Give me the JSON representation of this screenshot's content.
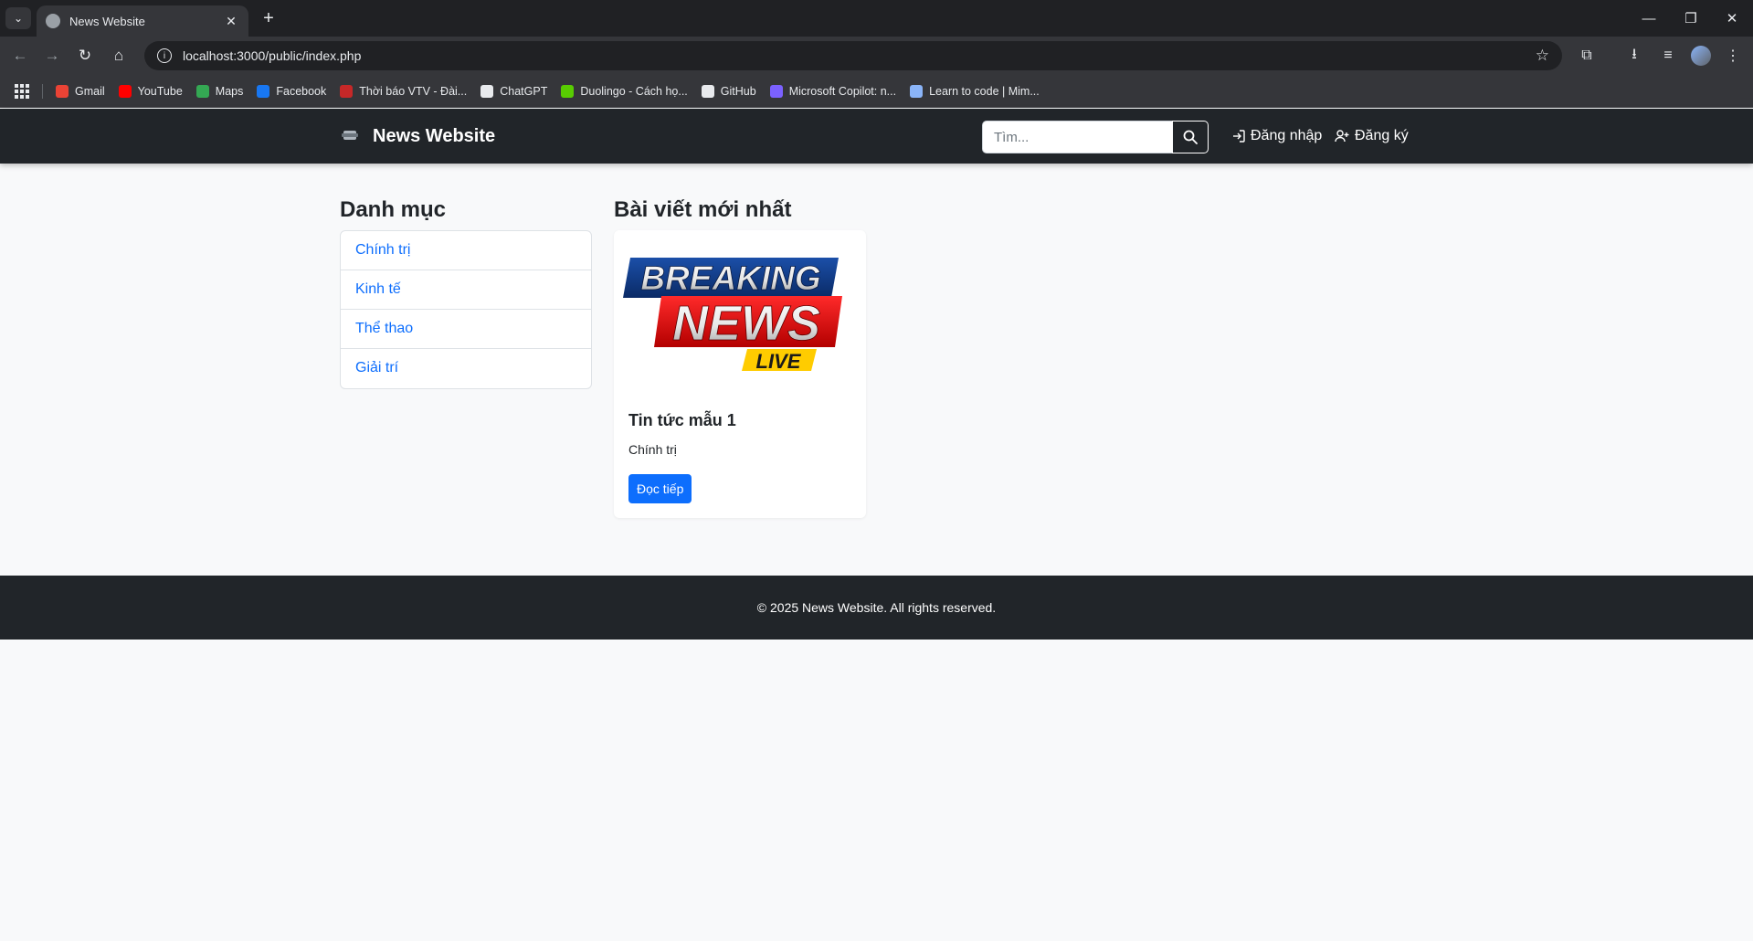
{
  "browser": {
    "tab_title": "News Website",
    "url": "localhost:3000/public/index.php",
    "bookmarks": [
      {
        "label": "Gmail",
        "icon": "gmail-icon",
        "color": "#ea4335"
      },
      {
        "label": "YouTube",
        "icon": "youtube-icon",
        "color": "#ff0000"
      },
      {
        "label": "Maps",
        "icon": "maps-icon",
        "color": "#34a853"
      },
      {
        "label": "Facebook",
        "icon": "facebook-icon",
        "color": "#1877f2"
      },
      {
        "label": "Thời báo VTV - Đài...",
        "icon": "vtv-icon",
        "color": "#c62828"
      },
      {
        "label": "ChatGPT",
        "icon": "chatgpt-icon",
        "color": "#e8eaed"
      },
      {
        "label": "Duolingo - Cách họ...",
        "icon": "duolingo-icon",
        "color": "#58cc02"
      },
      {
        "label": "GitHub",
        "icon": "github-icon",
        "color": "#e8eaed"
      },
      {
        "label": "Microsoft Copilot: n...",
        "icon": "copilot-icon",
        "color": "#7b61ff"
      },
      {
        "label": "Learn to code | Mim...",
        "icon": "mimo-icon",
        "color": "#8ab4f8"
      }
    ]
  },
  "site": {
    "brand": "News Website",
    "search_placeholder": "Tìm...",
    "login_label": "Đăng nhập",
    "register_label": "Đăng ký",
    "accent": "#0d6efd",
    "dark": "#212529"
  },
  "sidebar": {
    "title": "Danh mục",
    "categories": [
      "Chính trị",
      "Kinh tế",
      "Thể thao",
      "Giải trí"
    ]
  },
  "latest": {
    "title": "Bài viết mới nhất",
    "posts": [
      {
        "image_text_1": "BREAKING",
        "image_text_2": "NEWS",
        "image_text_3": "LIVE",
        "title": "Tin tức mẫu 1",
        "category": "Chính trị",
        "button": "Đọc tiếp"
      }
    ]
  },
  "footer": {
    "text": "© 2025 News Website. All rights reserved."
  }
}
